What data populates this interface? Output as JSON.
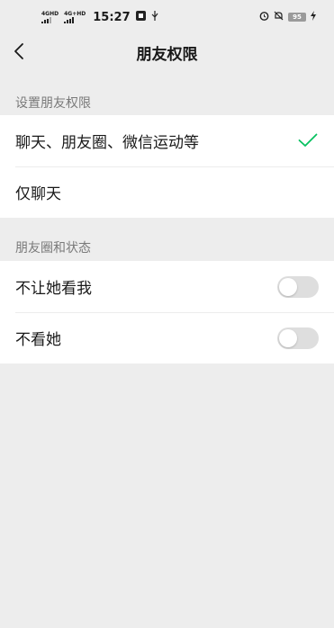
{
  "status_bar": {
    "sim1_label": "4GHD",
    "sim2_label": "4G+HD",
    "time": "15:27",
    "battery": "95"
  },
  "nav": {
    "title": "朋友权限"
  },
  "section_permissions": {
    "label": "设置朋友权限",
    "options": [
      {
        "label": "聊天、朋友圈、微信运动等",
        "selected": true
      },
      {
        "label": "仅聊天",
        "selected": false
      }
    ]
  },
  "section_moments": {
    "label": "朋友圈和状态",
    "toggles": [
      {
        "label": "不让她看我",
        "on": false
      },
      {
        "label": "不看她",
        "on": false
      }
    ]
  },
  "colors": {
    "accent": "#07c160",
    "background": "#ededed"
  }
}
